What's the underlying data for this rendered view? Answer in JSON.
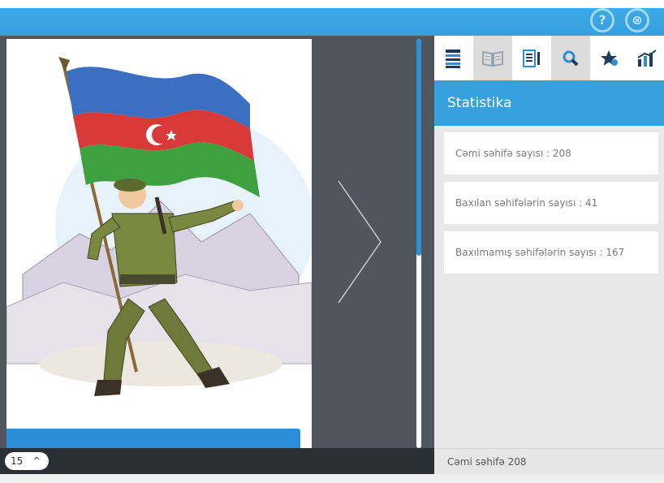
{
  "header": {
    "help_glyph": "?",
    "close_glyph": "⊗",
    "icons": [
      "help-icon",
      "close-icon"
    ]
  },
  "viewer": {
    "current_page": "15",
    "page_chevron": "^",
    "scroll_progress": 0.53
  },
  "toolbar": {
    "tools": [
      {
        "name": "contents",
        "icon": "list-icon"
      },
      {
        "name": "book",
        "icon": "open-book-icon"
      },
      {
        "name": "notes",
        "icon": "notes-icon"
      },
      {
        "name": "search",
        "icon": "search-icon"
      },
      {
        "name": "favorites",
        "icon": "star-icon"
      },
      {
        "name": "statistics",
        "icon": "chart-icon",
        "active": true
      }
    ]
  },
  "panel": {
    "title": "Statistika",
    "stats": [
      {
        "label": "Cəmi səhifə sayısı : 208"
      },
      {
        "label": "Baxılan səhifələrin sayısı : 41"
      },
      {
        "label": "Baxılmamış səhifələrin sayısı : 167"
      }
    ],
    "footer": "Cəmi səhifə 208"
  },
  "colors": {
    "accent": "#35a1de",
    "dark_bg": "#4f565e",
    "bottom_bar": "#2a3036"
  }
}
